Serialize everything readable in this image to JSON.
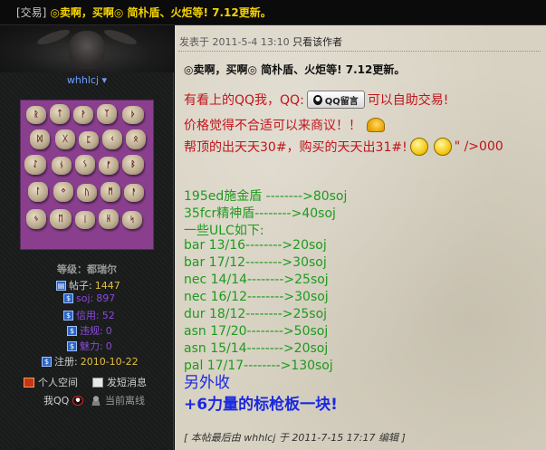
{
  "topbar": {
    "tag": "[交易]",
    "title": "◎卖啊，买啊◎ 简朴盾、火炬等! 7.12更新。"
  },
  "sidebar": {
    "username": "whhlcj",
    "rank": "等级：都瑞尔",
    "stats": [
      {
        "label": "帖子:",
        "value": "1447"
      },
      {
        "label": "soj:",
        "value": "897"
      },
      {
        "label": "信用:",
        "value": "52"
      },
      {
        "label": "违规:",
        "value": "0"
      },
      {
        "label": "魅力:",
        "value": "0"
      },
      {
        "label": "注册:",
        "value": "2010-10-22"
      }
    ],
    "links": {
      "space": "个人空间",
      "message": "发短消息",
      "qq": "我QQ",
      "status": "当前离线"
    }
  },
  "post": {
    "posted_label": "发表于",
    "posted_time": "2011-5-4 13:10",
    "author_only": "只看该作者",
    "title": "◎卖啊，买啊◎ 简朴盾、火炬等! 7.12更新。",
    "line1_a": "有看上的QQ我，QQ:",
    "qq_button": "QQ留言",
    "line1_b": "可以自助交易!",
    "line2": "价格觉得不合适可以来商议！！",
    "line3_a": "帮顶的出天天30#，购买的天天出31#!",
    "line3_b": "\" />000",
    "items": [
      "195ed施金盾  -------->80soj",
      "35fcr精神盾-------->40soj",
      "一些ULC如下:",
      "bar 13/16-------->20soj",
      "bar 17/12-------->30soj",
      "nec 14/14-------->25soj",
      "nec 16/12-------->30soj",
      "dur 18/12-------->25soj",
      "asn  17/20-------->50soj",
      "asn  15/14-------->20soj",
      "pal  17/17-------->130soj"
    ],
    "extra1": "另外收",
    "extra2": "+6力量的标枪板一块!",
    "edit_note": "[ 本帖最后由 whhlcj 于 2011-7-15 17:17 编辑 ]"
  },
  "colors": {
    "title_yellow": "#f2d200",
    "red_text": "#c0141b",
    "green_text": "#1e9a1e",
    "blue_text": "#1a28e0",
    "username_blue": "#6ea0ff"
  }
}
